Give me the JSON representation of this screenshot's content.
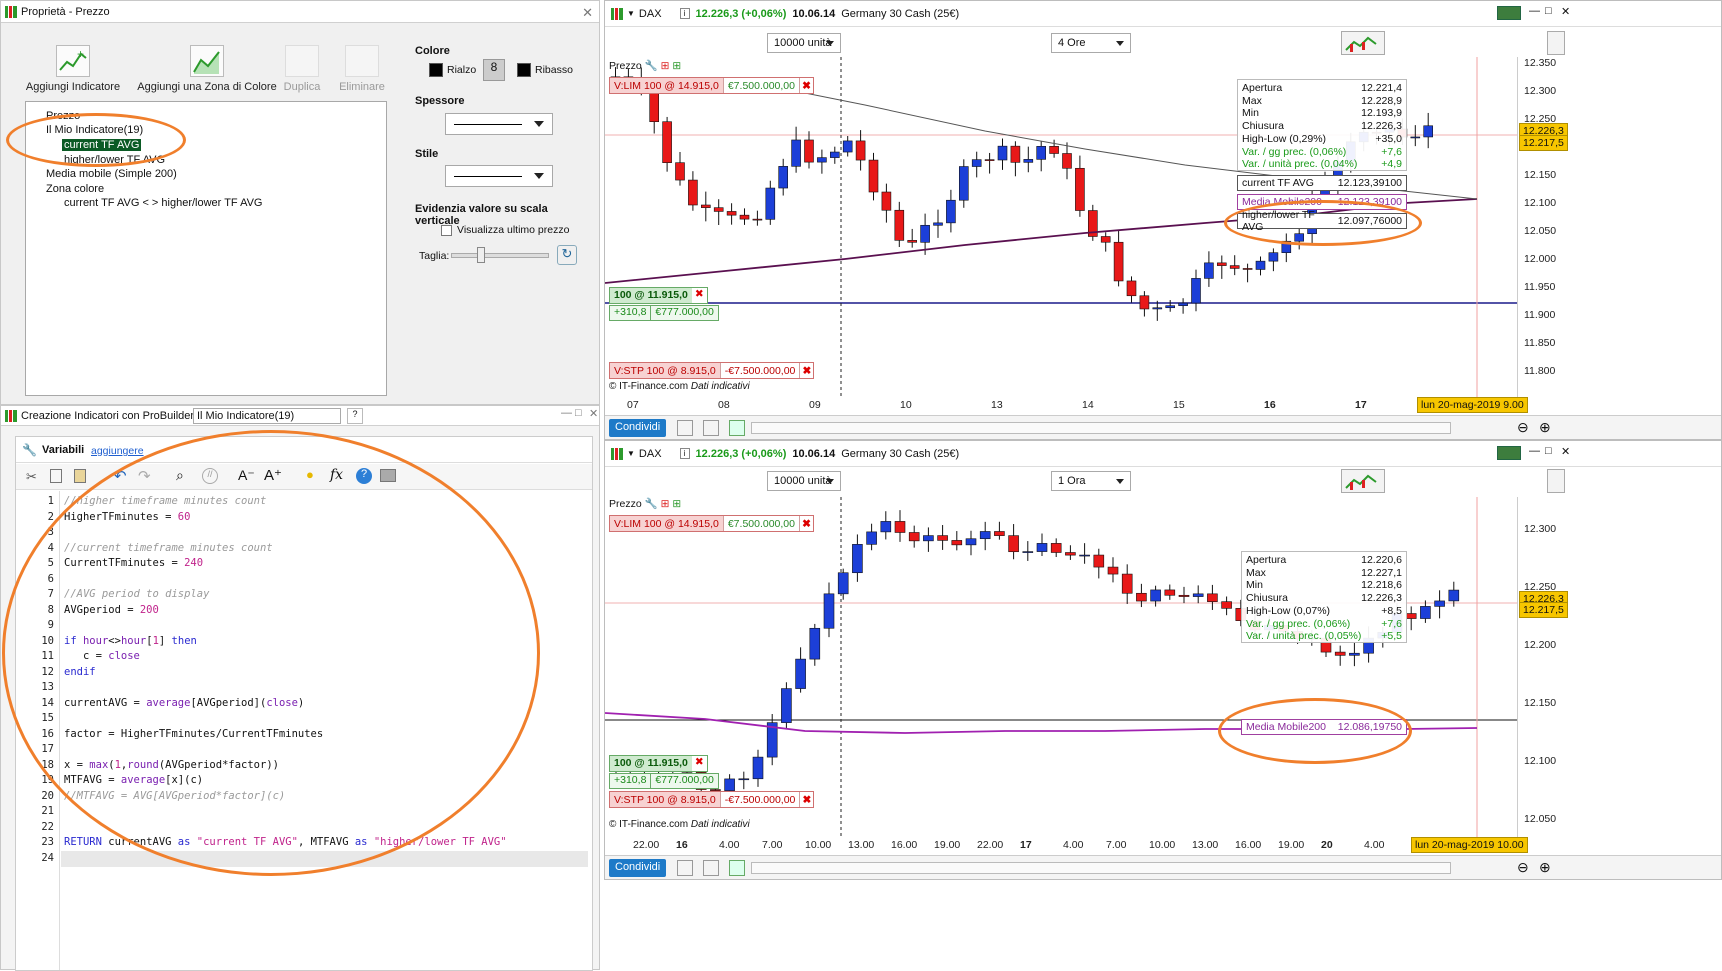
{
  "props": {
    "title": "Proprietà - Prezzo",
    "toolbar": {
      "add_indicator": "Aggiungi Indicatore",
      "add_color_zone": "Aggiungi una Zona di Colore",
      "duplicate": "Duplica",
      "delete": "Eliminare"
    },
    "tree": {
      "root": "Prezzo",
      "indicator": "Il Mio Indicatore(19)",
      "child1": "current TF AVG",
      "child2": "higher/lower TF AVG",
      "ma": "Media mobile (Simple 200)",
      "zone": "Zona colore",
      "zone_child": "current TF AVG < > higher/lower TF AVG"
    },
    "colore": "Colore",
    "rialzo": "Rialzo",
    "ribasso": "Ribasso",
    "spessore": "Spessore",
    "stile": "Stile",
    "evidenzia": "Evidenzia valore su scala verticale",
    "visualizza": "Visualizza ultimo prezzo",
    "taglia": "Taglia:"
  },
  "builder": {
    "title": "Creazione Indicatori con ProBuilder",
    "name": "Il Mio Indicatore(19)",
    "variabili": "Variabili",
    "aggiungere": "aggiungere",
    "lines": [
      {
        "n": "1",
        "t": "//higher timeframe minutes count"
      },
      {
        "n": "2",
        "t": "HigherTFminutes = 60"
      },
      {
        "n": "3",
        "t": ""
      },
      {
        "n": "4",
        "t": "//current timeframe minutes count"
      },
      {
        "n": "5",
        "t": "CurrentTFminutes = 240"
      },
      {
        "n": "6",
        "t": ""
      },
      {
        "n": "7",
        "t": "//AVG period to display"
      },
      {
        "n": "8",
        "t": "AVGperiod = 200"
      },
      {
        "n": "9",
        "t": ""
      },
      {
        "n": "10",
        "t": "if hour<>hour[1] then"
      },
      {
        "n": "11",
        "t": "   c = close"
      },
      {
        "n": "12",
        "t": "endif"
      },
      {
        "n": "13",
        "t": ""
      },
      {
        "n": "14",
        "t": "currentAVG = average[AVGperiod](close)"
      },
      {
        "n": "15",
        "t": ""
      },
      {
        "n": "16",
        "t": "factor = HigherTFminutes/CurrentTFminutes"
      },
      {
        "n": "17",
        "t": ""
      },
      {
        "n": "18",
        "t": "x = max(1,round(AVGperiod*factor))"
      },
      {
        "n": "19",
        "t": "MTFAVG = average[x](c)"
      },
      {
        "n": "20",
        "t": "//MTFAVG = AVG[AVGperiod*factor](c)"
      },
      {
        "n": "21",
        "t": ""
      },
      {
        "n": "22",
        "t": ""
      },
      {
        "n": "23",
        "t": "RETURN currentAVG as \"current TF AVG\", MTFAVG as \"higher/lower TF AVG\""
      },
      {
        "n": "24",
        "t": ""
      }
    ]
  },
  "chart1": {
    "symbol": "DAX",
    "price": "12.226,3 (+0,06%)",
    "time": "10.06.14",
    "name": "Germany 30 Cash (25€)",
    "units": "10000 unità",
    "tf": "4 Ore",
    "prezzo": "Prezzo",
    "vlim": "V:LIM  100 @ 14.915,0",
    "vlim_val": "€7.500.000,00",
    "pos": "100 @ 11.915,0",
    "pos_pts": "+310,8",
    "pos_val": "€777.000,00",
    "vstp": "V:STP  100 @ 8.915,0",
    "vstp_val": "-€7.500.000,00",
    "source": "© IT-Finance.com",
    "dati": "Dati indicativi",
    "info": [
      [
        "Apertura",
        "12.221,4"
      ],
      [
        "Max",
        "12.228,9"
      ],
      [
        "Min",
        "12.193,9"
      ],
      [
        "Chiusura",
        "12.226,3"
      ],
      [
        "High-Low (0,29%)",
        "+35,0"
      ],
      [
        "Var. / gg prec. (0,06%)",
        "+7,6"
      ],
      [
        "Var. / unità prec. (0,04%)",
        "+4,9"
      ]
    ],
    "tag_cur": [
      "current TF AVG",
      "12.123,39100"
    ],
    "tag_ma": [
      "Media Mobile200",
      "12.123,39100"
    ],
    "tag_hl": [
      "higher/lower TF AVG",
      "12.097,76000"
    ],
    "yaxis": [
      "12.350",
      "12.300",
      "12.250",
      "12.200",
      "12.150",
      "12.100",
      "12.050",
      "12.000",
      "11.950",
      "11.900",
      "11.850",
      "11.800"
    ],
    "badge_price": "12.226,3",
    "badge_price2": "12.217,5",
    "xaxis": [
      "07",
      "08",
      "09",
      "10",
      "13",
      "14",
      "15",
      "16",
      "17"
    ],
    "date": "lun 20-mag-2019 9.00",
    "share": "Condividi"
  },
  "chart2": {
    "symbol": "DAX",
    "price": "12.226,3 (+0,06%)",
    "time": "10.06.14",
    "name": "Germany 30 Cash (25€)",
    "units": "10000 unità",
    "tf": "1 Ora",
    "prezzo": "Prezzo",
    "vlim": "V:LIM  100 @ 14.915,0",
    "vlim_val": "€7.500.000,00",
    "pos": "100 @ 11.915,0",
    "pos_pts": "+310,8",
    "pos_val": "€777.000,00",
    "vstp": "V:STP  100 @ 8.915,0",
    "vstp_val": "-€7.500.000,00",
    "source": "© IT-Finance.com",
    "dati": "Dati indicativi",
    "info": [
      [
        "Apertura",
        "12.220,6"
      ],
      [
        "Max",
        "12.227,1"
      ],
      [
        "Min",
        "12.218,6"
      ],
      [
        "Chiusura",
        "12.226,3"
      ],
      [
        "High-Low (0,07%)",
        "+8,5"
      ],
      [
        "Var. / gg prec. (0,06%)",
        "+7,6"
      ],
      [
        "Var. / unità prec. (0,05%)",
        "+5,5"
      ]
    ],
    "tag_ma": [
      "Media Mobile200",
      "12.086,19750"
    ],
    "yaxis": [
      "12.300",
      "12.250",
      "12.200",
      "12.150",
      "12.100",
      "12.050"
    ],
    "badge_price": "12.226,3",
    "badge_price2": "12.217,5",
    "xaxis": [
      "22.00",
      "16",
      "4.00",
      "7.00",
      "10.00",
      "13.00",
      "16.00",
      "19.00",
      "22.00",
      "17",
      "4.00",
      "7.00",
      "10.00",
      "13.00",
      "16.00",
      "19.00",
      "20",
      "4.00"
    ],
    "date": "lun 20-mag-2019 10.00",
    "share": "Condividi"
  }
}
